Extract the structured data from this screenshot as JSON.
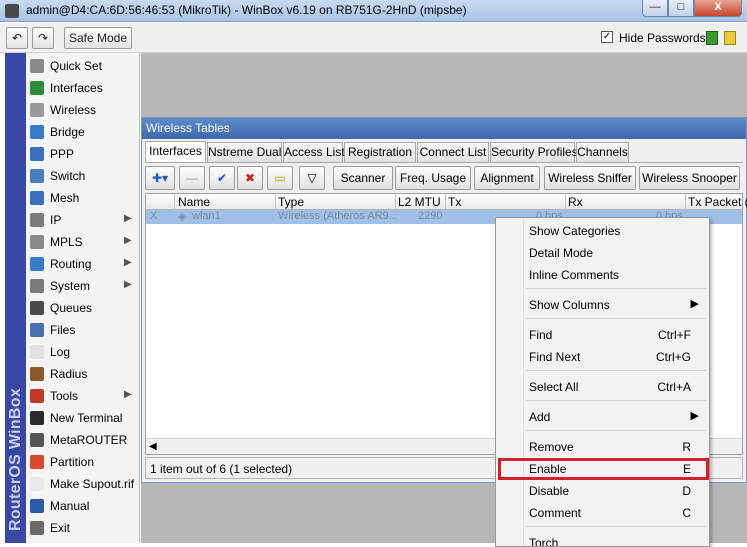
{
  "window": {
    "title": "admin@D4:CA:6D:56:46:53 (MikroTik) - WinBox v6.19 on RB751G-2HnD (mipsbe)",
    "controls": {
      "minimize": "—",
      "maximize": "□",
      "close": "X"
    }
  },
  "toolbar": {
    "undo": "↶",
    "redo": "↷",
    "safe_mode": "Safe Mode",
    "hide_passwords_label": "Hide Passwords",
    "hide_passwords_checked": true,
    "hide_passwords_mark": "✓"
  },
  "brand": "RouterOS WinBox",
  "sidebar": {
    "items": [
      {
        "label": "Quick Set",
        "icon": "quick-set-icon",
        "color": "#8a8a8a",
        "arrow": ""
      },
      {
        "label": "Interfaces",
        "icon": "interfaces-icon",
        "color": "#2e8b3a",
        "arrow": ""
      },
      {
        "label": "Wireless",
        "icon": "wireless-icon",
        "color": "#9a9a9a",
        "arrow": ""
      },
      {
        "label": "Bridge",
        "icon": "bridge-icon",
        "color": "#3a7bc8",
        "arrow": ""
      },
      {
        "label": "PPP",
        "icon": "ppp-icon",
        "color": "#3a6fbd",
        "arrow": ""
      },
      {
        "label": "Switch",
        "icon": "switch-icon",
        "color": "#4a7cc2",
        "arrow": ""
      },
      {
        "label": "Mesh",
        "icon": "mesh-icon",
        "color": "#3a6fbd",
        "arrow": ""
      },
      {
        "label": "IP",
        "icon": "ip-icon",
        "color": "#7a7a7a",
        "arrow": "▶"
      },
      {
        "label": "MPLS",
        "icon": "mpls-icon",
        "color": "#8a8a8a",
        "arrow": "▶"
      },
      {
        "label": "Routing",
        "icon": "routing-icon",
        "color": "#3a7bc8",
        "arrow": "▶"
      },
      {
        "label": "System",
        "icon": "system-icon",
        "color": "#7a7a7a",
        "arrow": "▶"
      },
      {
        "label": "Queues",
        "icon": "queues-icon",
        "color": "#4a4a4a",
        "arrow": ""
      },
      {
        "label": "Files",
        "icon": "files-icon",
        "color": "#4a6fb0",
        "arrow": ""
      },
      {
        "label": "Log",
        "icon": "log-icon",
        "color": "#e0e0e0",
        "arrow": ""
      },
      {
        "label": "Radius",
        "icon": "radius-icon",
        "color": "#8a5a2a",
        "arrow": ""
      },
      {
        "label": "Tools",
        "icon": "tools-icon",
        "color": "#c0392b",
        "arrow": "▶"
      },
      {
        "label": "New Terminal",
        "icon": "terminal-icon",
        "color": "#2a2a2a",
        "arrow": ""
      },
      {
        "label": "MetaROUTER",
        "icon": "metarouter-icon",
        "color": "#555555",
        "arrow": ""
      },
      {
        "label": "Partition",
        "icon": "partition-icon",
        "color": "#d94a2a",
        "arrow": ""
      },
      {
        "label": "Make Supout.rif",
        "icon": "supout-icon",
        "color": "#e8e8e8",
        "arrow": ""
      },
      {
        "label": "Manual",
        "icon": "manual-icon",
        "color": "#2a5aa8",
        "arrow": ""
      },
      {
        "label": "Exit",
        "icon": "exit-icon",
        "color": "#6a6a6a",
        "arrow": ""
      }
    ]
  },
  "wireless_tables": {
    "title": "Wireless Tables",
    "tabs": [
      "Interfaces",
      "Nstreme Dual",
      "Access List",
      "Registration",
      "Connect List",
      "Security Profiles",
      "Channels"
    ],
    "active_tab": 0,
    "tools": {
      "add": "✚▾",
      "remove": "—",
      "enable": "✔",
      "disable": "✖",
      "comment": "▭",
      "filter": "▽",
      "scanner": "Scanner",
      "freq_usage": "Freq. Usage",
      "alignment": "Alignment",
      "wireless_sniffer": "Wireless Sniffer",
      "wireless_snooper": "Wireless Snooper"
    },
    "columns": [
      "Name",
      "Type",
      "L2 MTU",
      "Tx",
      "Rx",
      "Tx Packet (p"
    ],
    "rows": [
      {
        "flag": "X",
        "name": "wlan1",
        "type": "Wireless (Atheros AR9...",
        "l2mtu": "2290",
        "tx": "0 bps",
        "rx": "0 bps"
      }
    ],
    "status": "1 item out of 6 (1 selected)"
  },
  "context_menu": {
    "items": [
      {
        "label": "Show Categories",
        "shortcut": "",
        "submenu": false
      },
      {
        "label": "Detail Mode",
        "shortcut": "",
        "submenu": false
      },
      {
        "label": "Inline Comments",
        "shortcut": "",
        "submenu": false
      },
      {
        "label": "Show Columns",
        "shortcut": "",
        "submenu": true
      },
      {
        "label": "Find",
        "shortcut": "Ctrl+F",
        "submenu": false
      },
      {
        "label": "Find Next",
        "shortcut": "Ctrl+G",
        "submenu": false
      },
      {
        "label": "Select All",
        "shortcut": "Ctrl+A",
        "submenu": false
      },
      {
        "label": "Add",
        "shortcut": "",
        "submenu": true
      },
      {
        "label": "Remove",
        "shortcut": "R",
        "submenu": false
      },
      {
        "label": "Enable",
        "shortcut": "E",
        "submenu": false
      },
      {
        "label": "Disable",
        "shortcut": "D",
        "submenu": false
      },
      {
        "label": "Comment",
        "shortcut": "C",
        "submenu": false
      },
      {
        "label": "Torch",
        "shortcut": "",
        "submenu": false
      }
    ],
    "submenu_arrow": "▶",
    "highlighted": "Enable",
    "highlight_color": "#d4202a"
  }
}
